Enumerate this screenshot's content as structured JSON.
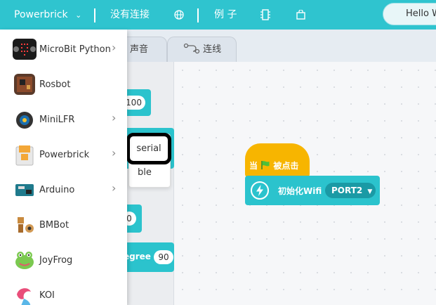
{
  "topbar": {
    "device_select": "Powerbrick",
    "connection_status": "没有连接",
    "examples_label": "例 子",
    "hello_text": "Hello W",
    "colors": {
      "background": "#2fc4cf",
      "text": "#ffffff"
    }
  },
  "tabs": [
    {
      "label": "声音",
      "icon": "music-icon"
    },
    {
      "label": "连线",
      "icon": "wire-icon"
    }
  ],
  "device_menu": {
    "items": [
      {
        "label": "MicroBit Python",
        "icon": "microbit-icon",
        "has_submenu": true
      },
      {
        "label": "Rosbot",
        "icon": "rosbot-board-icon",
        "has_submenu": false
      },
      {
        "label": "MiniLFR",
        "icon": "minilfr-robot-icon",
        "has_submenu": true
      },
      {
        "label": "Powerbrick",
        "icon": "powerbrick-icon",
        "has_submenu": true
      },
      {
        "label": "Arduino",
        "icon": "arduino-board-icon",
        "has_submenu": true
      },
      {
        "label": "BMBot",
        "icon": "bmbot-icon",
        "has_submenu": false
      },
      {
        "label": "JoyFrog",
        "icon": "joyfrog-icon",
        "has_submenu": false
      },
      {
        "label": "KOI",
        "icon": "koi-icon",
        "has_submenu": false
      }
    ]
  },
  "palette": {
    "pill_values": [
      "100",
      "0",
      "90"
    ],
    "degree_label": "egree",
    "dropdown_options": [
      "serial",
      "ble"
    ]
  },
  "workspace": {
    "hat_block": {
      "prefix": "当",
      "suffix": "被点击",
      "color": "#f7b500"
    },
    "wifi_block": {
      "label": "初始化Wifi",
      "port": "PORT2",
      "color": "#2bc3cd"
    }
  }
}
